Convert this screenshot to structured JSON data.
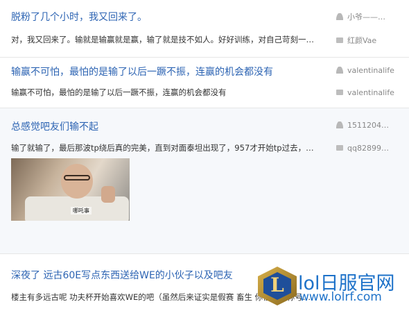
{
  "threads": [
    {
      "title": "脱粉了几个小时，我又回来了。",
      "excerpt": "对，我又回来了。输就是输赢就是赢，输了就是技不如人。好好训练，对自己苛刻一…",
      "author": "小爷——…",
      "last_reply": "红颜Vae"
    },
    {
      "title": "输赢不可怕，最怕的是输了以后一蹶不振，连赢的机会都没有",
      "excerpt": "输赢不可怕，最怕的是输了以后一蹶不振，连赢的机会都没有",
      "author": "valentinalife",
      "last_reply": "valentinalife"
    },
    {
      "title": "总感觉吧友们输不起",
      "excerpt": "输了就输了，最后那波tp绕后真的完美，直到对面泰坦出现了，957才开始tp过去，…",
      "author": "1511204…",
      "last_reply": "qq82899…",
      "image_caption": "哪吒事"
    },
    {
      "title": "深夜了 远古60E写点东西送给WE的小伙子以及吧友",
      "excerpt": "楼主有多远古呢 功夫杯开始喜欢WE的吧（虽然后来证实是假赛 畜生 你懂的）称号…"
    }
  ],
  "icons": {
    "author": "person-icon",
    "last_reply": "reply-icon"
  },
  "watermark": {
    "logo_letter": "L",
    "text": "lol日服官网",
    "url": "www.lolrf.com"
  },
  "colors": {
    "link": "#2d64b3",
    "meta": "#888888",
    "highlight_bg": "#f6f8fb",
    "watermark": "#1e72c9"
  }
}
